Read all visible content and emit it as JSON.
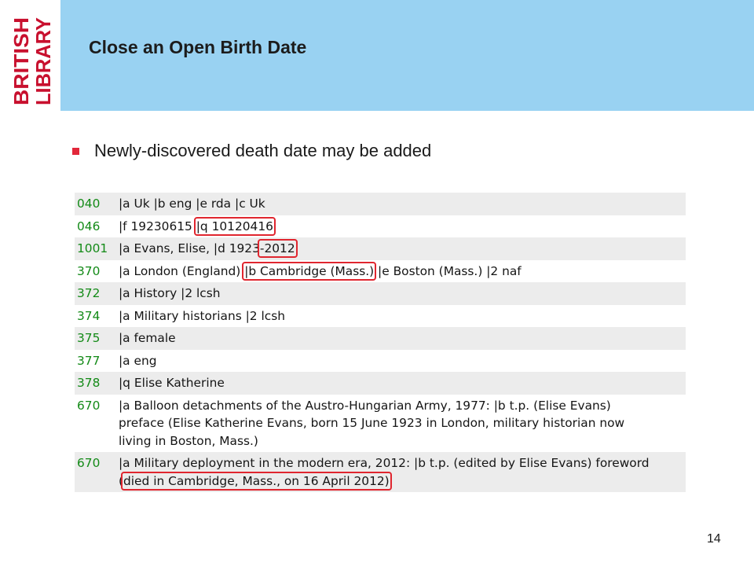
{
  "logo": {
    "line1": "BRITISH",
    "line2": "LIBRARY",
    "color": "#c8102e"
  },
  "header": {
    "title": "Close an Open Birth Date",
    "bg": "#99d2f2"
  },
  "bullet": {
    "text": "Newly-discovered death date may be added",
    "marker_color": "#e2273a"
  },
  "records": [
    {
      "tag": "040",
      "parts": [
        {
          "t": "|a Uk |b eng |e rda |c Uk"
        }
      ]
    },
    {
      "tag": "046",
      "parts": [
        {
          "t": "|f 19230615 "
        },
        {
          "t": "|q 10120416",
          "hl": true
        }
      ]
    },
    {
      "tag": "1001",
      "parts": [
        {
          "t": "|a Evans, Elise, |d 1923"
        },
        {
          "t": "-2012",
          "hl": true
        }
      ]
    },
    {
      "tag": "370",
      "parts": [
        {
          "t": "|a London (England) "
        },
        {
          "t": "|b Cambridge (Mass.)",
          "hl": true
        },
        {
          "t": " |e Boston (Mass.) |2 naf"
        }
      ]
    },
    {
      "tag": "372",
      "parts": [
        {
          "t": "|a History |2 lcsh"
        }
      ]
    },
    {
      "tag": "374",
      "parts": [
        {
          "t": "|a Military historians |2 lcsh"
        }
      ]
    },
    {
      "tag": "375",
      "parts": [
        {
          "t": "|a female"
        }
      ]
    },
    {
      "tag": "377",
      "parts": [
        {
          "t": "|a eng"
        }
      ]
    },
    {
      "tag": "378",
      "parts": [
        {
          "t": "|q Elise Katherine"
        }
      ]
    },
    {
      "tag": "670",
      "parts": [
        {
          "t": "|a Balloon detachments of the Austro-Hungarian Army, 1977: |b t.p. (Elise Evans) preface (Elise Katherine Evans, born 15 June 1923 in London, military historian now living in Boston, Mass.)"
        }
      ]
    },
    {
      "tag": "670",
      "parts": [
        {
          "t": "|a Military deployment in the modern era, 2012: |b t.p. (edited by Elise Evans) foreword ("
        },
        {
          "t": "died in Cambridge, Mass., on 16 April 2012)",
          "hl": true
        }
      ]
    }
  ],
  "page_number": "14"
}
